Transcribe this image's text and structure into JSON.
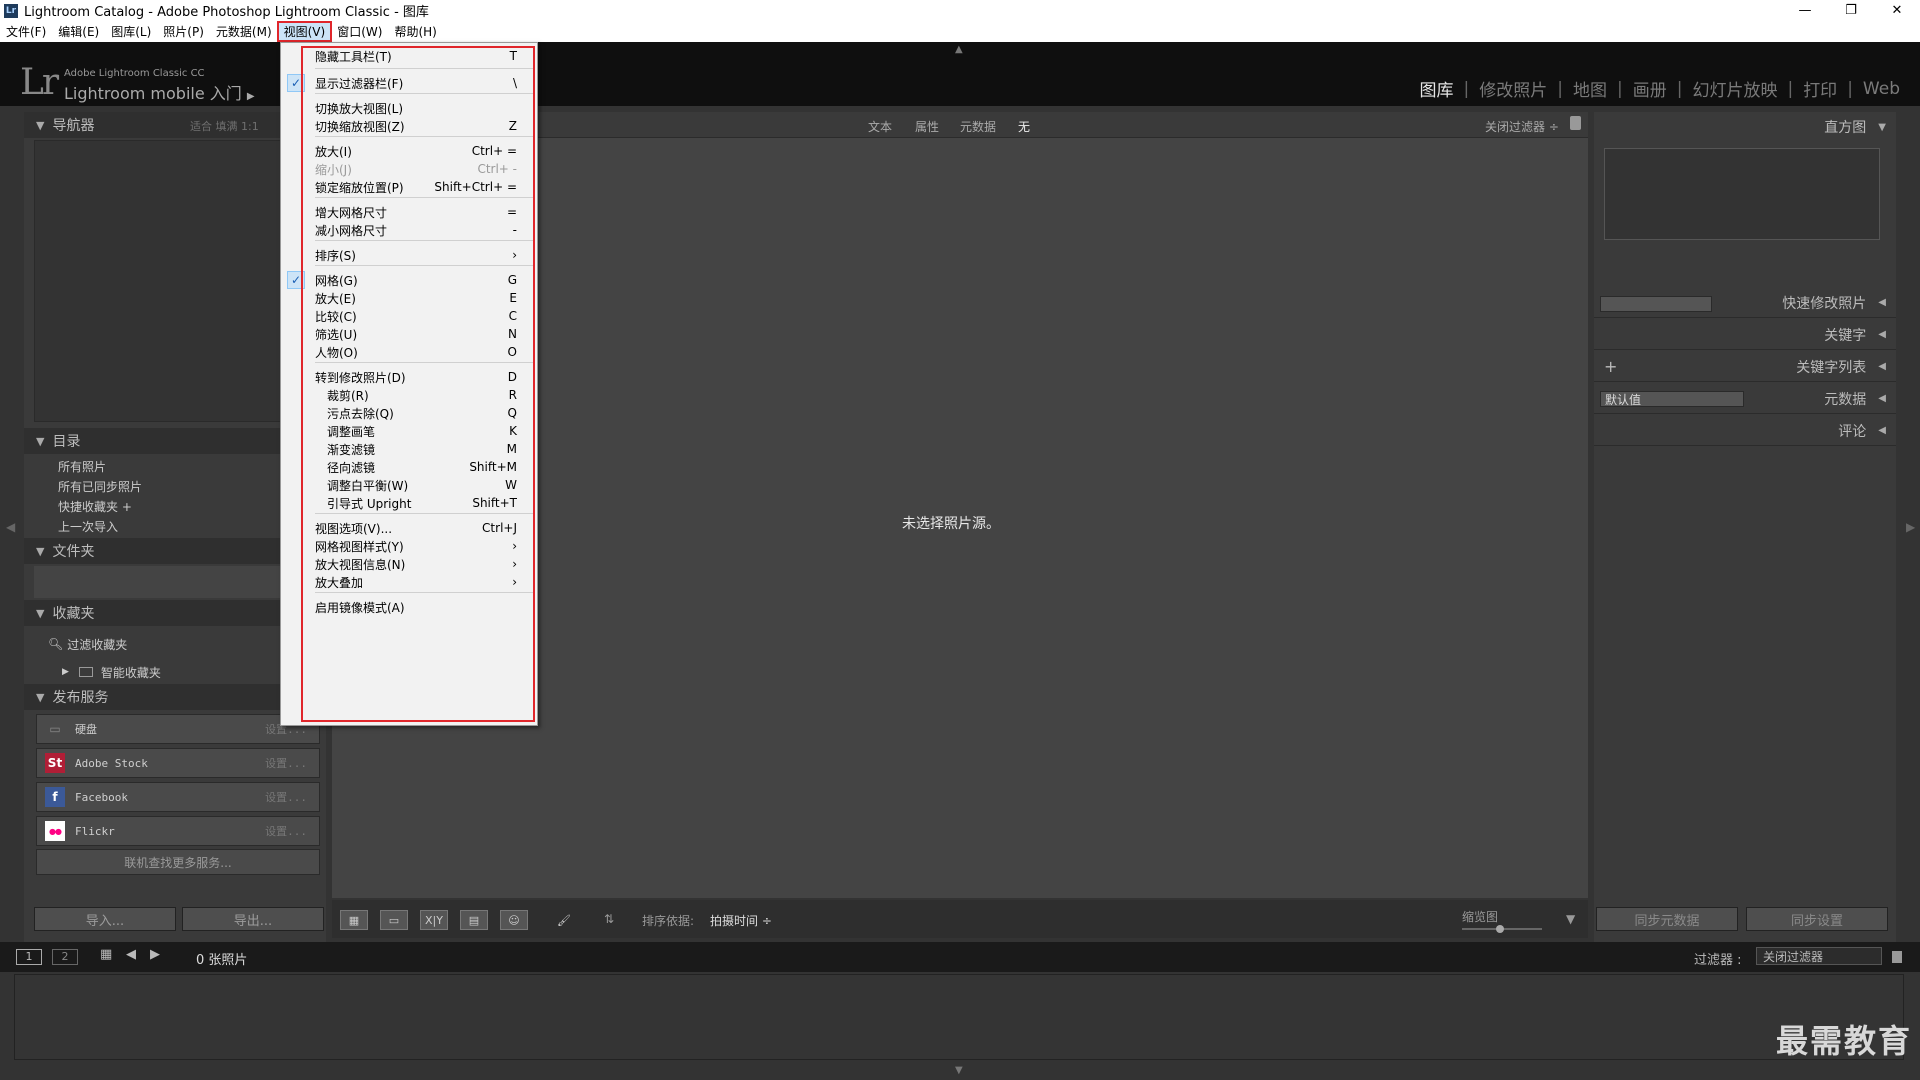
{
  "window": {
    "app_icon": "Lr",
    "title": "Lightroom Catalog - Adobe Photoshop Lightroom Classic - 图库",
    "controls": [
      "—",
      "❐",
      "✕"
    ]
  },
  "menubar": [
    "文件(F)",
    "编辑(E)",
    "图库(L)",
    "照片(P)",
    "元数据(M)",
    "视图(V)",
    "窗口(W)",
    "帮助(H)"
  ],
  "identity": {
    "logo": "Lr",
    "line1": "Adobe Lightroom Classic CC",
    "line2": "Lightroom mobile 入门",
    "arrow": "▶"
  },
  "modules": {
    "items": [
      "图库",
      "修改照片",
      "地图",
      "画册",
      "幻灯片放映",
      "打印",
      "Web"
    ],
    "separator": "|",
    "active": "图库"
  },
  "left_panel": {
    "navigator": {
      "title": "导航器",
      "options": "适合   填满   1:1"
    },
    "catalog": {
      "title": "目录",
      "items": [
        "所有照片",
        "所有已同步照片",
        "快捷收藏夹 +",
        "上一次导入"
      ]
    },
    "folders": {
      "title": "文件夹"
    },
    "collections": {
      "title": "收藏夹",
      "filter": "过滤收藏夹",
      "smart": "智能收藏夹"
    },
    "publish": {
      "title": "发布服务",
      "services": [
        {
          "icon": "▭",
          "name": "硬盘",
          "setup": "设置..."
        },
        {
          "icon": "St",
          "name": "Adobe Stock",
          "setup": "设置..."
        },
        {
          "icon": "f",
          "name": "Facebook",
          "setup": "设置..."
        },
        {
          "icon": "●●",
          "name": "Flickr",
          "setup": "设置..."
        }
      ],
      "find_more": "联机查找更多服务..."
    },
    "import_btn": "导入...",
    "export_btn": "导出..."
  },
  "filter_bar": {
    "options": [
      "文本",
      "属性",
      "元数据",
      "无"
    ],
    "active": "无",
    "filter_state": "关闭过滤器 ÷"
  },
  "center": {
    "empty_message": "未选择照片源。"
  },
  "toolbar": {
    "sort_label": "排序依据:",
    "sort_value": "拍摄时间 ÷",
    "thumb_label": "缩览图",
    "compare_label": "X|Y"
  },
  "right_panel": {
    "histogram": "直方图",
    "quick_develop": "快速修改照片",
    "keywording": "关键字",
    "keyword_list": "关键字列表",
    "keyword_add": "+",
    "metadata": "元数据",
    "metadata_preset": "默认值",
    "comments": "评论",
    "sync_metadata": "同步元数据",
    "sync_settings": "同步设置"
  },
  "filmstrip": {
    "screen1": "1",
    "screen2": "2",
    "count": "0 张照片",
    "filter_label": "过滤器 :",
    "filter_value": "关闭过滤器"
  },
  "watermark": "最需教育",
  "view_menu": [
    {
      "label": "隐藏工具栏(T)",
      "shortcut": "T"
    },
    {
      "sep": true
    },
    {
      "label": "显示过滤器栏(F)",
      "shortcut": "\\",
      "checked": true
    },
    {
      "sep": true
    },
    {
      "label": "切换放大视图(L)",
      "shortcut": ""
    },
    {
      "label": "切换缩放视图(Z)",
      "shortcut": "Z"
    },
    {
      "sep": true
    },
    {
      "label": "放大(I)",
      "shortcut": "Ctrl+ ="
    },
    {
      "label": "缩小(J)",
      "shortcut": "Ctrl+ -",
      "disabled": true
    },
    {
      "label": "锁定缩放位置(P)",
      "shortcut": "Shift+Ctrl+ ="
    },
    {
      "sep": true
    },
    {
      "label": "增大网格尺寸",
      "shortcut": "="
    },
    {
      "label": "减小网格尺寸",
      "shortcut": "-"
    },
    {
      "sep": true
    },
    {
      "label": "排序(S)",
      "shortcut": "›"
    },
    {
      "sep": true
    },
    {
      "label": "网格(G)",
      "shortcut": "G",
      "checked": true
    },
    {
      "label": "放大(E)",
      "shortcut": "E"
    },
    {
      "label": "比较(C)",
      "shortcut": "C"
    },
    {
      "label": "筛选(U)",
      "shortcut": "N"
    },
    {
      "label": "人物(O)",
      "shortcut": "O"
    },
    {
      "sep": true
    },
    {
      "label": "转到修改照片(D)",
      "shortcut": "D"
    },
    {
      "label": "裁剪(R)",
      "shortcut": "R",
      "sub": true
    },
    {
      "label": "污点去除(Q)",
      "shortcut": "Q",
      "sub": true
    },
    {
      "label": "调整画笔",
      "shortcut": "K",
      "sub": true
    },
    {
      "label": "渐变滤镜",
      "shortcut": "M",
      "sub": true
    },
    {
      "label": "径向滤镜",
      "shortcut": "Shift+M",
      "sub": true
    },
    {
      "label": "调整白平衡(W)",
      "shortcut": "W",
      "sub": true
    },
    {
      "label": "引导式 Upright",
      "shortcut": "Shift+T",
      "sub": true
    },
    {
      "sep": true
    },
    {
      "label": "视图选项(V)...",
      "shortcut": "Ctrl+J"
    },
    {
      "label": "网格视图样式(Y)",
      "shortcut": "›"
    },
    {
      "label": "放大视图信息(N)",
      "shortcut": "›"
    },
    {
      "label": "放大叠加",
      "shortcut": "›"
    },
    {
      "sep": true
    },
    {
      "label": "启用镜像模式(A)",
      "shortcut": ""
    }
  ]
}
